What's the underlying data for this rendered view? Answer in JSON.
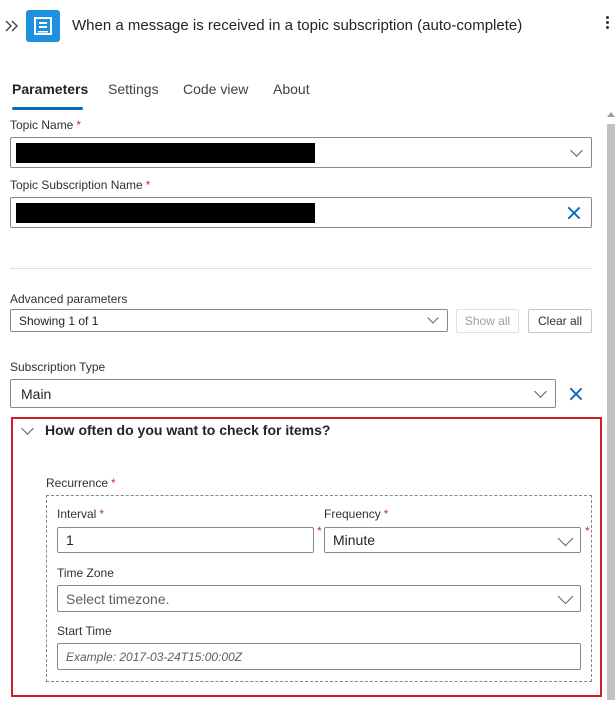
{
  "header": {
    "title": "When a message is received in a topic subscription (auto-complete)",
    "collapse_icon": "double-chevron-right-icon",
    "trigger_icon": "service-bus-icon",
    "more_icon": "more-vertical-icon"
  },
  "tabs": [
    {
      "label": "Parameters",
      "active": true
    },
    {
      "label": "Settings",
      "active": false
    },
    {
      "label": "Code view",
      "active": false
    },
    {
      "label": "About",
      "active": false
    }
  ],
  "fields": {
    "topic_name": {
      "label": "Topic Name",
      "required": "*"
    },
    "topic_subscription_name": {
      "label": "Topic Subscription Name",
      "required": "*"
    },
    "advanced_parameters": {
      "label": "Advanced parameters",
      "value": "Showing 1 of 1",
      "show_all": "Show all",
      "clear_all": "Clear all"
    },
    "subscription_type": {
      "label": "Subscription Type",
      "value": "Main"
    }
  },
  "recurrence_section": {
    "title": "How often do you want to check for items?",
    "recurrence_label": "Recurrence",
    "required": "*",
    "interval": {
      "label": "Interval",
      "value": "1"
    },
    "frequency": {
      "label": "Frequency",
      "value": "Minute"
    },
    "time_zone": {
      "label": "Time Zone",
      "value": "Select timezone."
    },
    "start_time": {
      "label": "Start Time",
      "placeholder": "Example: 2017-03-24T15:00:00Z"
    }
  },
  "colors": {
    "accent": "#0f6cbd",
    "trigger_icon_bg": "#1f8fe0",
    "required": "#c4314b",
    "highlight_border": "#d11e24"
  }
}
